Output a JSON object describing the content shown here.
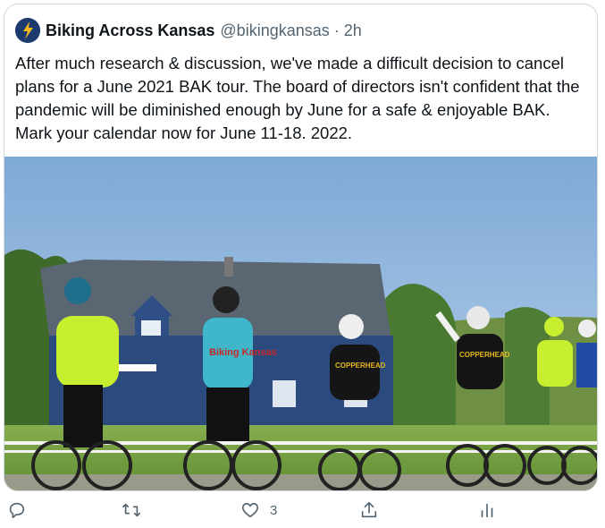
{
  "tweet": {
    "author_name": "Biking Across Kansas",
    "author_handle": "@bikingkansas",
    "separator": "·",
    "time": "2h",
    "text": "After much research & discussion, we've made a difficult decision to cancel plans for a June 2021 BAK tour. The board of directors isn't confident that the pandemic will be diminished enough by June for a safe & enjoyable BAK. Mark your calendar now for June 11-18. 2022.",
    "like_count": "3"
  },
  "photo_signs": {
    "jersey_left": "Biking Kansas",
    "jersey_middle": "COPPERHEAD",
    "jersey_right": "COPPERHEAD"
  },
  "colors": {
    "accent": "#1d9bf0",
    "text_secondary": "#536471",
    "border": "#cfd9de",
    "sky": "#8db4dc",
    "grass": "#6a9a3c"
  },
  "icons": {
    "reply": "reply-icon",
    "retweet": "retweet-icon",
    "like": "heart-icon",
    "share": "share-icon",
    "analytics": "analytics-icon"
  }
}
